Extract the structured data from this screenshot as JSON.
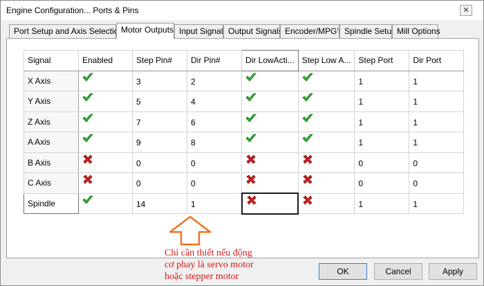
{
  "window": {
    "title": "Engine Configuration... Ports & Pins",
    "close_glyph": "✕"
  },
  "tabs": [
    {
      "label": "Port Setup and Axis Selection",
      "active": false
    },
    {
      "label": "Motor Outputs",
      "active": true
    },
    {
      "label": "Input Signals",
      "active": false
    },
    {
      "label": "Output Signals",
      "active": false
    },
    {
      "label": "Encoder/MPG's",
      "active": false
    },
    {
      "label": "Spindle Setup",
      "active": false
    },
    {
      "label": "Mill Options",
      "active": false
    }
  ],
  "grid": {
    "columns": [
      "Signal",
      "Enabled",
      "Step Pin#",
      "Dir Pin#",
      "Dir LowActi...",
      "Step Low A...",
      "Step Port",
      "Dir Port"
    ],
    "rows": [
      {
        "signal": "X Axis",
        "enabled": "check-icon",
        "step_pin": "3",
        "dir_pin": "2",
        "dir_low": "check-icon",
        "step_low": "check-icon",
        "step_port": "1",
        "dir_port": "1"
      },
      {
        "signal": "Y Axis",
        "enabled": "check-icon",
        "step_pin": "5",
        "dir_pin": "4",
        "dir_low": "check-icon",
        "step_low": "check-icon",
        "step_port": "1",
        "dir_port": "1"
      },
      {
        "signal": "Z Axis",
        "enabled": "check-icon",
        "step_pin": "7",
        "dir_pin": "6",
        "dir_low": "check-icon",
        "step_low": "check-icon",
        "step_port": "1",
        "dir_port": "1"
      },
      {
        "signal": "A Axis",
        "enabled": "check-icon",
        "step_pin": "9",
        "dir_pin": "8",
        "dir_low": "check-icon",
        "step_low": "check-icon",
        "step_port": "1",
        "dir_port": "1"
      },
      {
        "signal": "B Axis",
        "enabled": "cross-icon",
        "step_pin": "0",
        "dir_pin": "0",
        "dir_low": "cross-icon",
        "step_low": "cross-icon",
        "step_port": "0",
        "dir_port": "0"
      },
      {
        "signal": "C Axis",
        "enabled": "cross-icon",
        "step_pin": "0",
        "dir_pin": "0",
        "dir_low": "cross-icon",
        "step_low": "cross-icon",
        "step_port": "0",
        "dir_port": "0"
      },
      {
        "signal": "Spindle",
        "enabled": "check-icon",
        "step_pin": "14",
        "dir_pin": "1",
        "dir_low": "cross-icon",
        "step_low": "cross-icon",
        "step_port": "1",
        "dir_port": "1"
      }
    ]
  },
  "annotation": {
    "lines": [
      "Chỉ cần thiết nếu động",
      "cơ phay là servo motor",
      "hoặc stepper motor"
    ],
    "color": "#d01818",
    "arrow_fill": "#ffffff",
    "arrow_stroke": "#f07020"
  },
  "buttons": {
    "ok": "OK",
    "cancel": "Cancel",
    "apply": "Apply"
  },
  "colors": {
    "check_green": "#2fb52f",
    "check_dark": "#1d6e1d",
    "cross_red": "#d42020",
    "cross_dark": "#7a1010"
  }
}
